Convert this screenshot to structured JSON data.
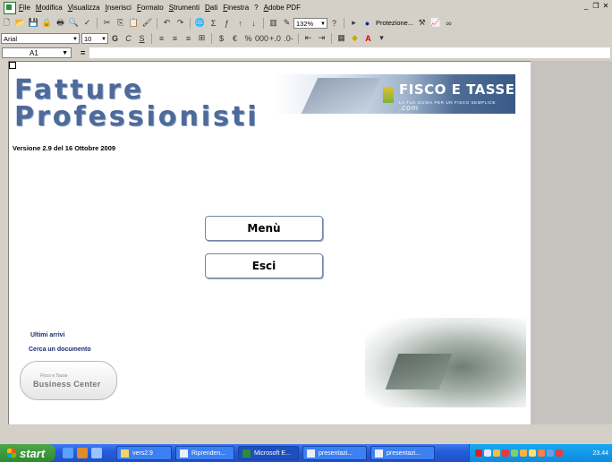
{
  "menubar": {
    "items": [
      "File",
      "Modifica",
      "Visualizza",
      "Inserisci",
      "Formato",
      "Strumenti",
      "Dati",
      "Finestra",
      "?",
      "Adobe PDF"
    ]
  },
  "toolbar": {
    "zoom": "132%",
    "protection_label": "Protezione..."
  },
  "format_toolbar": {
    "font": "Arial",
    "size": "10",
    "bold": "G",
    "italic": "C",
    "underline": "S"
  },
  "formula": {
    "cell": "A1",
    "equals": "="
  },
  "sheet": {
    "title_line1": "Fatture",
    "title_line2": "Professionisti",
    "version": "Versione 2.9 del 16 Ottobre 2009",
    "banner_brand": "FISCO E TASSE",
    "banner_suffix": ".com",
    "banner_tagline": "LA TUA GUIDA PER UN FISCO SEMPLICE",
    "menu_button": "Menù",
    "exit_button": "Esci",
    "link_recent": "Ultimi arrivi",
    "link_search": "Cerca un documento",
    "bc_small": "Fisco e Tasse",
    "bc_big": "Business Center"
  },
  "taskbar": {
    "start": "start",
    "tasks": [
      "vers2.9",
      "Riprenden...",
      "Microsoft E...",
      "presentazi...",
      "presentazi..."
    ],
    "clock": "23.44"
  },
  "colors": {
    "title": "#4d6a9a",
    "taskbar": "#245edb",
    "start": "#2e8a2e"
  }
}
